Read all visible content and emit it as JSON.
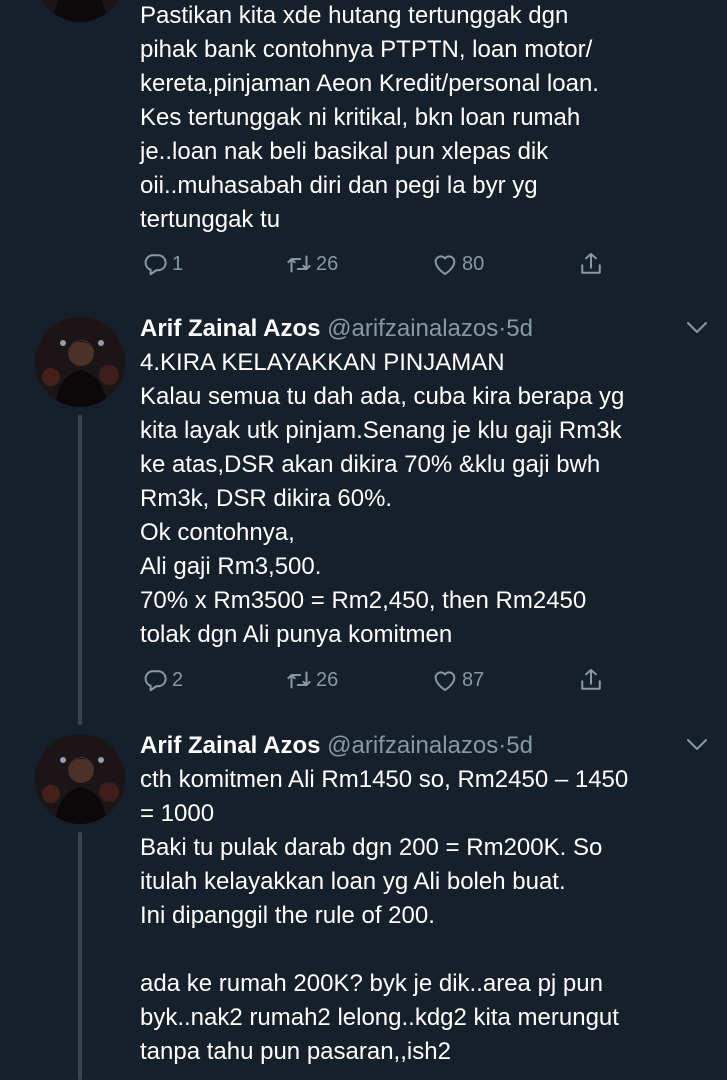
{
  "tweets": [
    {
      "text": "Pastikan kita xde hutang tertunggak dgn\npihak bank contohnya PTPTN, loan motor/\nkereta,pinjaman Aeon Kredit/personal loan.\nKes tertunggak ni kritikal, bkn loan rumah\nje..loan nak beli basikal pun xlepas dik\noii..muhasabah diri dan pegi la byr yg\ntertunggak tu",
      "replies": "1",
      "retweets": "26",
      "likes": "80"
    },
    {
      "name": "Arif Zainal Azos",
      "handle": "@arifzainalazos",
      "separator": "·",
      "time": "5d",
      "text": "4.KIRA KELAYAKKAN PINJAMAN\nKalau semua tu dah ada, cuba kira berapa yg\nkita layak utk pinjam.Senang je klu gaji Rm3k\nke atas,DSR akan dikira 70% &klu gaji bwh\nRm3k, DSR dikira 60%.\nOk contohnya,\nAli gaji Rm3,500.\n70% x Rm3500 = Rm2,450, then Rm2450\ntolak dgn Ali punya komitmen",
      "replies": "2",
      "retweets": "26",
      "likes": "87"
    },
    {
      "name": "Arif Zainal Azos",
      "handle": "@arifzainalazos",
      "separator": "·",
      "time": "5d",
      "text": "cth komitmen Ali Rm1450 so, Rm2450 – 1450\n= 1000\nBaki tu pulak darab dgn 200 = Rm200K. So\nitulah kelayakkan loan yg Ali boleh buat.\nIni dipanggil the rule of 200.\n\nada ke rumah 200K? byk je dik..area pj pun\nbyk..nak2 rumah2 lelong..kdg2 kita merungut\ntanpa tahu pun pasaran,,ish2"
    }
  ],
  "icons": {
    "reply": "reply-icon",
    "retweet": "retweet-icon",
    "like": "heart-icon",
    "share": "share-icon",
    "more": "chevron-down-icon"
  },
  "colors": {
    "background": "#15202b",
    "text": "#ffffff",
    "secondary": "#8899a6",
    "thread_line": "#38444d"
  }
}
